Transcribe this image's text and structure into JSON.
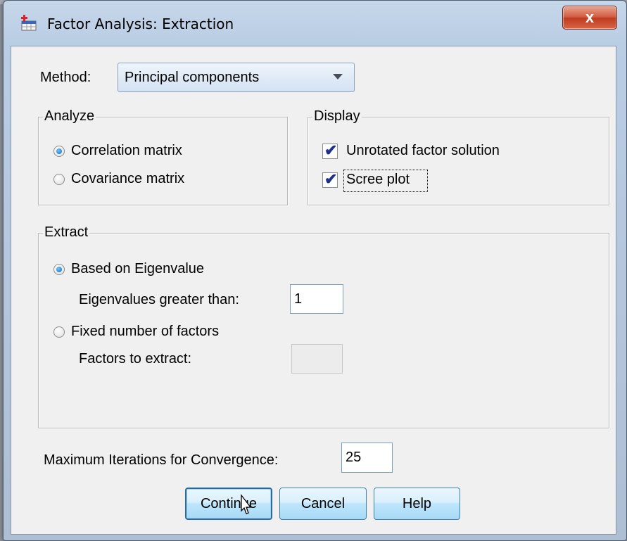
{
  "window": {
    "title": "Factor Analysis: Extraction",
    "close_glyph": "x"
  },
  "method": {
    "label": "Method:",
    "selected": "Principal components"
  },
  "analyze": {
    "legend": "Analyze",
    "options": [
      {
        "label": "Correlation matrix",
        "selected": true
      },
      {
        "label": "Covariance matrix",
        "selected": false
      }
    ]
  },
  "display": {
    "legend": "Display",
    "options": [
      {
        "label": "Unrotated factor solution",
        "checked": true
      },
      {
        "label": "Scree plot",
        "checked": true
      }
    ]
  },
  "extract": {
    "legend": "Extract",
    "eigen_option": "Based on Eigenvalue",
    "eigen_threshold_label": "Eigenvalues greater than:",
    "eigen_threshold_value": "1",
    "fixed_option": "Fixed number of factors",
    "factors_label": "Factors to extract:",
    "factors_value": ""
  },
  "iterations": {
    "label": "Maximum Iterations for Convergence:",
    "value": "25"
  },
  "buttons": {
    "continue": "Continue",
    "cancel": "Cancel",
    "help": "Help"
  },
  "icons": {
    "app": "spss-factor-icon",
    "radio_color": "#1466b8",
    "check_color": "#1c2f8a"
  }
}
